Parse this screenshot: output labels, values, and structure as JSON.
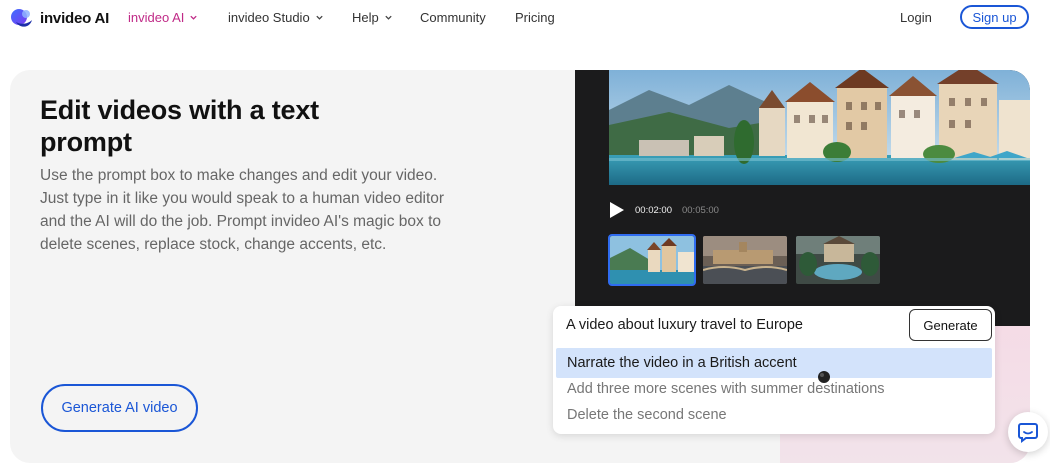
{
  "nav": {
    "logo_text": "invideo AI",
    "items": [
      {
        "label": "invideo AI",
        "dropdown": true,
        "active": true
      },
      {
        "label": "invideo Studio",
        "dropdown": true
      },
      {
        "label": "Help",
        "dropdown": true
      },
      {
        "label": "Community"
      },
      {
        "label": "Pricing"
      }
    ],
    "login": "Login",
    "signup": "Sign up"
  },
  "hero": {
    "title": "Edit videos with a text prompt",
    "description": "Use the prompt box to make changes and edit your video. Just type in it like you would speak to a human video editor and the AI will do the job. Prompt invideo AI's magic box to delete scenes, replace stock, change accents, etc.",
    "cta": "Generate AI video"
  },
  "editor": {
    "current_time": "00:02:00",
    "total_time": "00:05:00",
    "thumbnails": [
      {
        "name": "lakeside-village",
        "selected": true
      },
      {
        "name": "city-bridge",
        "selected": false
      },
      {
        "name": "resort-pool",
        "selected": false
      }
    ]
  },
  "prompt": {
    "value": "A video about luxury travel to Europe",
    "generate_label": "Generate",
    "suggestions": [
      {
        "label": "Narrate the video in a British accent",
        "highlighted": true
      },
      {
        "label": "Add three more scenes with summer destinations",
        "highlighted": false
      },
      {
        "label": "Delete the second scene",
        "highlighted": false
      }
    ]
  },
  "colors": {
    "brand_blue": "#1a56d6",
    "active_nav": "#c02a87",
    "card_bg": "#f4f4f4",
    "editor_bg": "#1b1b1c",
    "highlight": "#d3e3fb"
  }
}
